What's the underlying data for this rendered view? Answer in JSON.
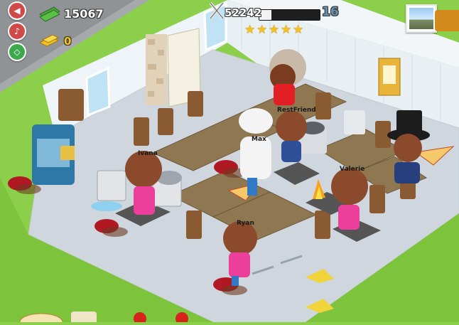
{
  "hud": {
    "coins": "15067",
    "gold": "0",
    "xp": "52242",
    "xp_progress": 0.2,
    "level": "16",
    "stars": 5,
    "icons": {
      "sound": "speaker-mute-icon",
      "music": "music-note-icon",
      "settings": "settings-diamond-icon",
      "coins": "cash-stack-icon",
      "gold": "gold-bars-icon",
      "xp": "fork-knife-icon"
    }
  },
  "characters": [
    {
      "name": "RestFriend"
    },
    {
      "name": "Max"
    },
    {
      "name": "Ivana"
    },
    {
      "name": "Valerie"
    },
    {
      "name": "Ryan"
    }
  ],
  "colors": {
    "grass": "#8ccf4a",
    "floor": "#cfd6dd",
    "wall": "#eef4f7",
    "table": "#8f7752",
    "xp_bar": "#1f1f1f"
  }
}
